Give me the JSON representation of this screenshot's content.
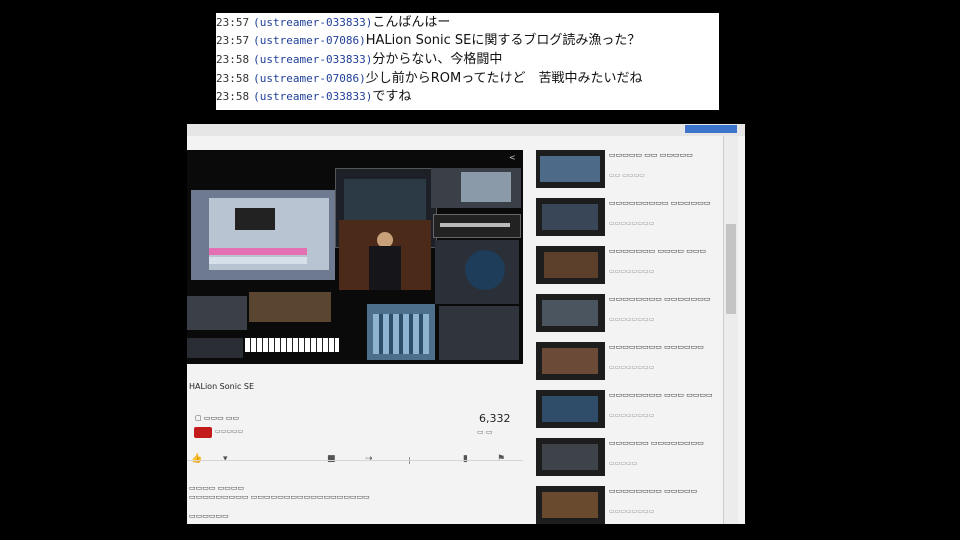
{
  "chat": {
    "lines": [
      {
        "time": "23:57",
        "user": "(ustreamer-033833)",
        "message": "こんばんはー"
      },
      {
        "time": "23:57",
        "user": "(ustreamer-07086)",
        "message": "HALion Sonic SEに関するブログ読み漁った？"
      },
      {
        "time": "23:58",
        "user": "(ustreamer-033833)",
        "message": "分からない、今格闘中"
      },
      {
        "time": "23:58",
        "user": "(ustreamer-07086)",
        "message": "少し前からROMってたけど　苦戦中みたいだね"
      },
      {
        "time": "23:58",
        "user": "(ustreamer-033833)",
        "message": "ですね"
      }
    ]
  },
  "video": {
    "title": "HALion Sonic SE",
    "views": "6,332",
    "progress": 0.4
  },
  "colors": {
    "accent_red": "#cc0000",
    "username_blue": "#1f3f99",
    "top_bar_blue": "#3d75cc"
  }
}
